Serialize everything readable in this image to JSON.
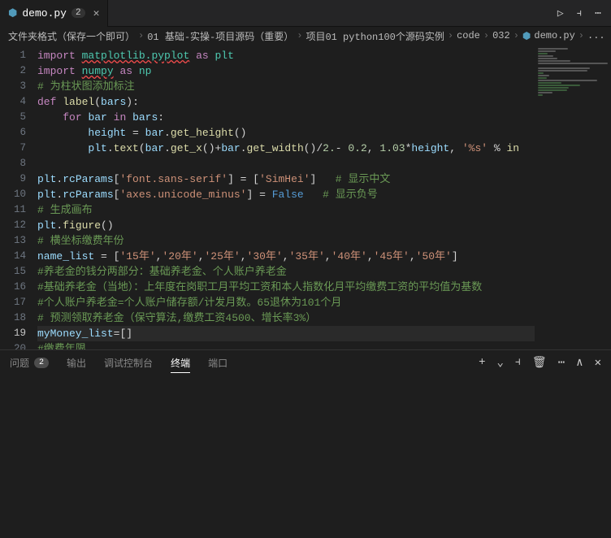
{
  "tab": {
    "filename": "demo.py",
    "badge": "2"
  },
  "toprighticons": {
    "run": "▷",
    "split": "⫞",
    "more": "⋯"
  },
  "breadcrumb": {
    "items": [
      "文件夹格式（保存一个即可）",
      "01 基础-实操-项目源码（重要）",
      "项目01 python100个源码实例",
      "code",
      "032"
    ],
    "file": "demo.py",
    "trailing": "..."
  },
  "panel": {
    "tabs": {
      "problems": "问题",
      "output": "输出",
      "debug": "调试控制台",
      "terminal": "终端",
      "ports": "端口"
    },
    "problem_count": "2",
    "icons": {
      "plus": "+",
      "dropdown": "⌄",
      "split": "⫞",
      "trash": "🗑",
      "more": "⋯",
      "up": "∧",
      "close": "✕"
    }
  },
  "code": {
    "lines": [
      {
        "n": 1,
        "tokens": [
          [
            "kw",
            "import"
          ],
          [
            "pun",
            " "
          ],
          [
            "err mod",
            "matplotlib.pyplot"
          ],
          [
            "pun",
            " "
          ],
          [
            "kw",
            "as"
          ],
          [
            "pun",
            " "
          ],
          [
            "mod",
            "plt"
          ]
        ]
      },
      {
        "n": 2,
        "tokens": [
          [
            "kw",
            "import"
          ],
          [
            "pun",
            " "
          ],
          [
            "err mod",
            "numpy"
          ],
          [
            "pun",
            " "
          ],
          [
            "kw",
            "as"
          ],
          [
            "pun",
            " "
          ],
          [
            "mod",
            "np"
          ]
        ]
      },
      {
        "n": 3,
        "tokens": [
          [
            "cmt",
            "# 为柱状图添加标注"
          ]
        ]
      },
      {
        "n": 4,
        "tokens": [
          [
            "kw",
            "def"
          ],
          [
            "pun",
            " "
          ],
          [
            "fn",
            "label"
          ],
          [
            "pun",
            "("
          ],
          [
            "var",
            "bars"
          ],
          [
            "pun",
            "):"
          ]
        ]
      },
      {
        "n": 5,
        "tokens": [
          [
            "pun",
            "    "
          ],
          [
            "kw",
            "for"
          ],
          [
            "pun",
            " "
          ],
          [
            "var",
            "bar"
          ],
          [
            "pun",
            " "
          ],
          [
            "kw",
            "in"
          ],
          [
            "pun",
            " "
          ],
          [
            "var",
            "bars"
          ],
          [
            "pun",
            ":"
          ]
        ]
      },
      {
        "n": 6,
        "tokens": [
          [
            "pun",
            "        "
          ],
          [
            "var",
            "height"
          ],
          [
            "op",
            " = "
          ],
          [
            "var",
            "bar"
          ],
          [
            "pun",
            "."
          ],
          [
            "fn",
            "get_height"
          ],
          [
            "pun",
            "()"
          ]
        ]
      },
      {
        "n": 7,
        "tokens": [
          [
            "pun",
            "        "
          ],
          [
            "var",
            "plt"
          ],
          [
            "pun",
            "."
          ],
          [
            "fn",
            "text"
          ],
          [
            "pun",
            "("
          ],
          [
            "var",
            "bar"
          ],
          [
            "pun",
            "."
          ],
          [
            "fn",
            "get_x"
          ],
          [
            "pun",
            "()+"
          ],
          [
            "var",
            "bar"
          ],
          [
            "pun",
            "."
          ],
          [
            "fn",
            "get_width"
          ],
          [
            "pun",
            "()/"
          ],
          [
            "num",
            "2."
          ],
          [
            "op",
            "- "
          ],
          [
            "num",
            "0.2"
          ],
          [
            "pun",
            ", "
          ],
          [
            "num",
            "1.03"
          ],
          [
            "op",
            "*"
          ],
          [
            "var",
            "height"
          ],
          [
            "pun",
            ", "
          ],
          [
            "str",
            "'%s'"
          ],
          [
            "op",
            " % "
          ],
          [
            "fn",
            "in"
          ]
        ]
      },
      {
        "n": 8,
        "tokens": [
          [
            "pun",
            ""
          ]
        ]
      },
      {
        "n": 9,
        "tokens": [
          [
            "var",
            "plt"
          ],
          [
            "pun",
            "."
          ],
          [
            "var",
            "rcParams"
          ],
          [
            "pun",
            "["
          ],
          [
            "str",
            "'font.sans-serif'"
          ],
          [
            "pun",
            "] = ["
          ],
          [
            "str",
            "'SimHei'"
          ],
          [
            "pun",
            "]   "
          ],
          [
            "cmt",
            "# 显示中文"
          ]
        ]
      },
      {
        "n": 10,
        "tokens": [
          [
            "var",
            "plt"
          ],
          [
            "pun",
            "."
          ],
          [
            "var",
            "rcParams"
          ],
          [
            "pun",
            "["
          ],
          [
            "str",
            "'axes.unicode_minus'"
          ],
          [
            "pun",
            "] = "
          ],
          [
            "bool",
            "False"
          ],
          [
            "pun",
            "   "
          ],
          [
            "cmt",
            "# 显示负号"
          ]
        ]
      },
      {
        "n": 11,
        "tokens": [
          [
            "cmt",
            "# 生成画布"
          ]
        ]
      },
      {
        "n": 12,
        "tokens": [
          [
            "var",
            "plt"
          ],
          [
            "pun",
            "."
          ],
          [
            "fn",
            "figure"
          ],
          [
            "pun",
            "()"
          ]
        ]
      },
      {
        "n": 13,
        "tokens": [
          [
            "cmt",
            "# 横坐标缴费年份"
          ]
        ]
      },
      {
        "n": 14,
        "tokens": [
          [
            "var",
            "name_list"
          ],
          [
            "op",
            " = "
          ],
          [
            "pun",
            "["
          ],
          [
            "str",
            "'15年'"
          ],
          [
            "pun",
            ","
          ],
          [
            "str",
            "'20年'"
          ],
          [
            "pun",
            ","
          ],
          [
            "str",
            "'25年'"
          ],
          [
            "pun",
            ","
          ],
          [
            "str",
            "'30年'"
          ],
          [
            "pun",
            ","
          ],
          [
            "str",
            "'35年'"
          ],
          [
            "pun",
            ","
          ],
          [
            "str",
            "'40年'"
          ],
          [
            "pun",
            ","
          ],
          [
            "str",
            "'45年'"
          ],
          [
            "pun",
            ","
          ],
          [
            "str",
            "'50年'"
          ],
          [
            "pun",
            "]"
          ]
        ]
      },
      {
        "n": 15,
        "tokens": [
          [
            "cmt",
            "#养老金的钱分两部分：基础养老金、个人账户养老金"
          ]
        ]
      },
      {
        "n": 16,
        "tokens": [
          [
            "cmt",
            "#基础养老金（当地）：上年度在岗职工月平均工资和本人指数化月平均缴费工资的平均值为基数"
          ]
        ]
      },
      {
        "n": 17,
        "tokens": [
          [
            "cmt",
            "#个人账户养老金=个人账户储存额/计发月数。65退休为101个月"
          ]
        ]
      },
      {
        "n": 18,
        "tokens": [
          [
            "cmt",
            "# 预测领取养老金（保守算法,缴费工资4500、增长率3%）"
          ]
        ]
      },
      {
        "n": 19,
        "tokens": [
          [
            "var",
            "myMoney_list"
          ],
          [
            "op",
            "="
          ],
          [
            "pun",
            "[]"
          ]
        ]
      },
      {
        "n": 20,
        "tokens": [
          [
            "cmt",
            "#缴费年限"
          ]
        ]
      }
    ],
    "current_line": 19
  }
}
